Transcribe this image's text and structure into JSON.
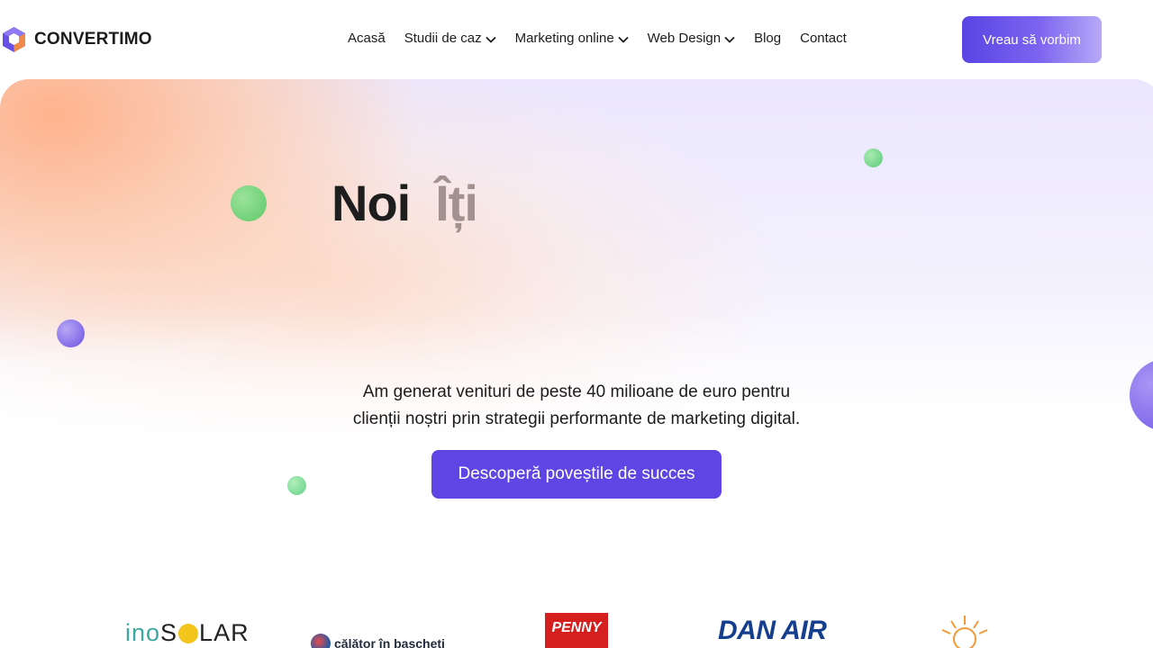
{
  "header": {
    "logo_text": "CONVERTIMO",
    "logo_icon": "cube-logo-icon",
    "nav": [
      {
        "label": "Acasă",
        "dropdown": false
      },
      {
        "label": "Studii de caz",
        "dropdown": true
      },
      {
        "label": "Marketing online",
        "dropdown": true
      },
      {
        "label": "Web Design",
        "dropdown": true
      },
      {
        "label": "Blog",
        "dropdown": false
      },
      {
        "label": "Contact",
        "dropdown": false
      }
    ],
    "cta_label": "Vreau să vorbim"
  },
  "hero": {
    "headline_word1": "Noi",
    "headline_word2": "Îți",
    "subtitle_line1": "Am generat venituri de peste 40 milioane de euro pentru",
    "subtitle_line2": "clienții noștri prin strategii performante de marketing digital.",
    "cta_label": "Descoperă poveștile de succes"
  },
  "logos": {
    "ino_prefix": "ino",
    "ino_suffix": "LAR",
    "calator": "călător în bascheți",
    "penny": "PENNY",
    "danair": "DAN AIR"
  },
  "colors": {
    "accent": "#5f45e3",
    "headline_dark": "#1e1e1e",
    "headline_muted": "#a39190",
    "green_dot": "#5ec86a",
    "purple_dot": "#6b52e3"
  }
}
